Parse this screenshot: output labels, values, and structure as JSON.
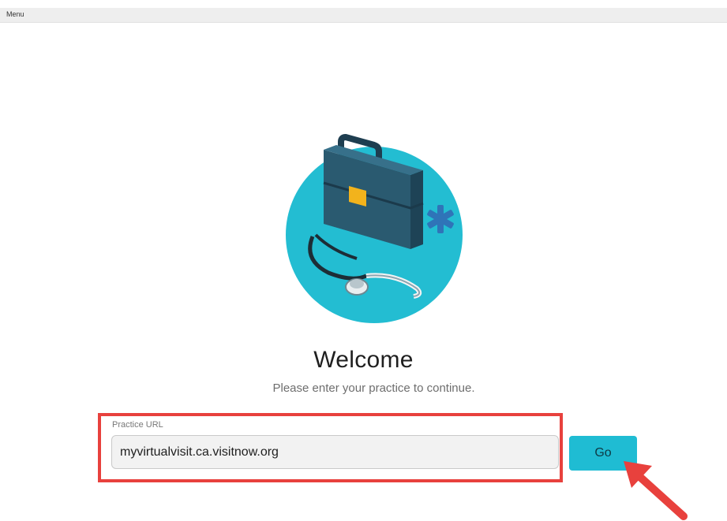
{
  "menubar": {
    "label": "Menu"
  },
  "hero": {
    "title": "Welcome",
    "subtitle": "Please enter your practice to continue.",
    "illustration_icon": "medical-briefcase-stethoscope-icon"
  },
  "form": {
    "field_label": "Practice URL",
    "url_value": "myvirtualvisit.ca.visitnow.org",
    "go_label": "Go"
  },
  "colors": {
    "accent": "#1fbcd3",
    "highlight": "#e8413d",
    "briefcase": "#264e63"
  }
}
